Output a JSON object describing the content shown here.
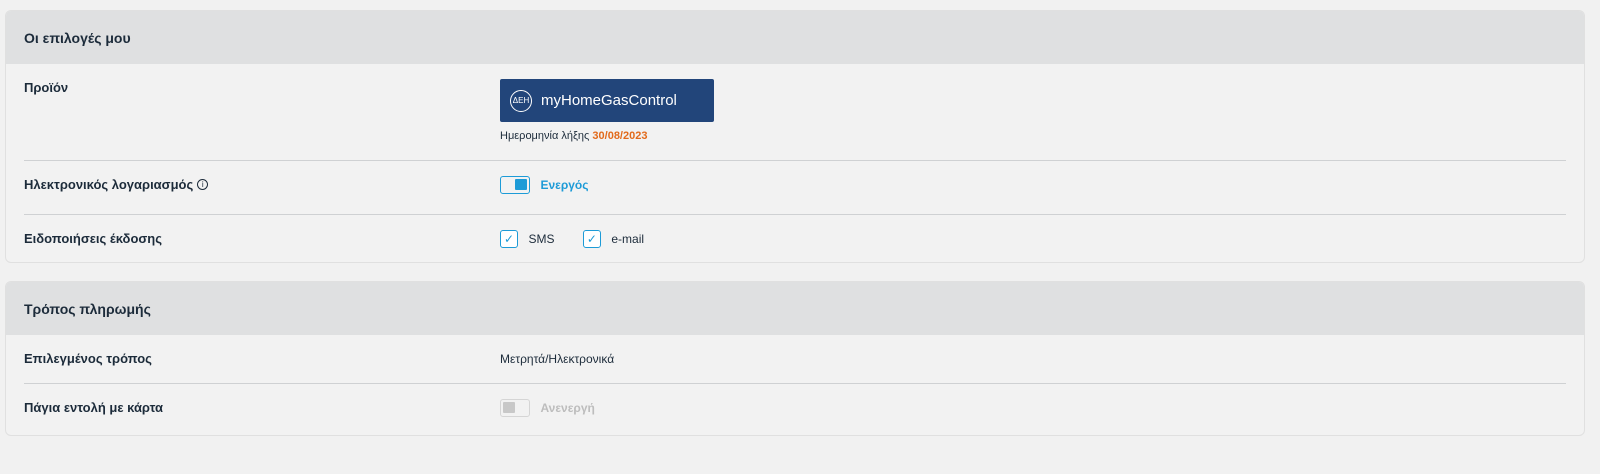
{
  "section1": {
    "title": "Οι επιλογές μου",
    "product": {
      "label": "Προϊόν",
      "logo_text": "ΔΕΗ",
      "name": "myHomeGasControl",
      "expiry_label": "Ημερομηνία λήξης",
      "expiry_date": "30/08/2023"
    },
    "e_account": {
      "label": "Ηλεκτρονικός λογαριασμός",
      "info_symbol": "i",
      "status": "Ενεργός",
      "enabled": true
    },
    "notifications": {
      "label": "Ειδοποιήσεις έκδοσης",
      "options": [
        {
          "label": "SMS",
          "checked": true
        },
        {
          "label": "e-mail",
          "checked": true
        }
      ]
    }
  },
  "section2": {
    "title": "Τρόπος πληρωμής",
    "selected_method": {
      "label": "Επιλεγμένος τρόπος",
      "value": "Μετρητά/Ηλεκτρονικά"
    },
    "standing_order": {
      "label": "Πάγια εντολή με κάρτα",
      "status": "Ανενεργή",
      "enabled": false
    }
  },
  "colors": {
    "accent": "#1d9bd7",
    "brand_badge": "#22457a",
    "date_highlight": "#e26a1b",
    "header_bg": "#dfe0e1"
  }
}
